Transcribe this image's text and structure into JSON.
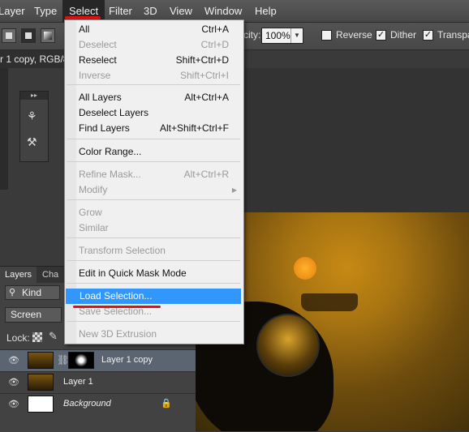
{
  "menubar": {
    "items": [
      "Layer",
      "Type",
      "Select",
      "Filter",
      "3D",
      "View",
      "Window",
      "Help"
    ],
    "active": "Select"
  },
  "options": {
    "opacity_label": "city:",
    "opacity_value": "100%",
    "reverse_label": "Reverse",
    "reverse_checked": false,
    "dither_label": "Dither",
    "dither_checked": true,
    "transparency_label": "Transpar"
  },
  "document": {
    "tab_title": "r 1 copy, RGB/8"
  },
  "select_menu": {
    "groups": [
      [
        {
          "label": "All",
          "shortcut": "Ctrl+A",
          "enabled": true
        },
        {
          "label": "Deselect",
          "shortcut": "Ctrl+D",
          "enabled": false
        },
        {
          "label": "Reselect",
          "shortcut": "Shift+Ctrl+D",
          "enabled": true
        },
        {
          "label": "Inverse",
          "shortcut": "Shift+Ctrl+I",
          "enabled": false
        }
      ],
      [
        {
          "label": "All Layers",
          "shortcut": "Alt+Ctrl+A",
          "enabled": true
        },
        {
          "label": "Deselect Layers",
          "shortcut": "",
          "enabled": true
        },
        {
          "label": "Find Layers",
          "shortcut": "Alt+Shift+Ctrl+F",
          "enabled": true
        }
      ],
      [
        {
          "label": "Color Range...",
          "shortcut": "",
          "enabled": true
        }
      ],
      [
        {
          "label": "Refine Mask...",
          "shortcut": "Alt+Ctrl+R",
          "enabled": false
        },
        {
          "label": "Modify",
          "shortcut": "",
          "enabled": false,
          "submenu": true
        }
      ],
      [
        {
          "label": "Grow",
          "shortcut": "",
          "enabled": false
        },
        {
          "label": "Similar",
          "shortcut": "",
          "enabled": false
        }
      ],
      [
        {
          "label": "Transform Selection",
          "shortcut": "",
          "enabled": false
        }
      ],
      [
        {
          "label": "Edit in Quick Mask Mode",
          "shortcut": "",
          "enabled": true
        }
      ],
      [
        {
          "label": "Load Selection...",
          "shortcut": "",
          "enabled": true,
          "highlighted": true
        },
        {
          "label": "Save Selection...",
          "shortcut": "",
          "enabled": false
        }
      ],
      [
        {
          "label": "New 3D Extrusion",
          "shortcut": "",
          "enabled": false
        }
      ]
    ]
  },
  "layers_panel": {
    "tabs": [
      "Layers",
      "Cha"
    ],
    "kind_label": "Kind",
    "blend_mode": "Screen",
    "lock_label": "Lock:",
    "layers": [
      {
        "name": "Layer 1 copy",
        "selected": true,
        "has_mask": true
      },
      {
        "name": "Layer 1",
        "selected": false,
        "has_mask": false
      },
      {
        "name": "Background",
        "selected": false,
        "locked": true
      }
    ]
  },
  "colors": {
    "highlight": "#3297fd",
    "annotation_red": "#e01010",
    "menu_bg": "#f0f0f0"
  }
}
